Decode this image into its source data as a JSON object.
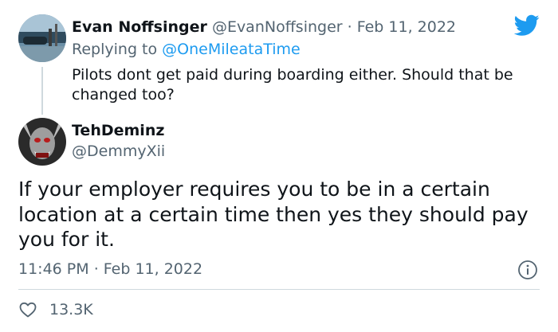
{
  "reply_tweet": {
    "author_name": "Evan Noffsinger",
    "handle": "@EvanNoffsinger",
    "separator": " · ",
    "date": "Feb 11, 2022",
    "replying_prefix": "Replying to ",
    "replying_to": "@OneMileataTime",
    "text": "Pilots dont get paid during boarding either. Should that be changed too?"
  },
  "main_tweet": {
    "author_name": "TehDeminz",
    "handle": "@DemmyXii",
    "text": "If your employer requires you to be in a certain location at a certain time then yes they should pay you for it.",
    "time": "11:46 PM",
    "separator": " · ",
    "date": "Feb 11, 2022",
    "like_count": "13.3K"
  },
  "icons": {
    "brand": "twitter-bird-icon",
    "info": "info-icon",
    "like": "heart-icon"
  },
  "colors": {
    "brand_blue": "#1d9bf0",
    "text_primary": "#0f1419",
    "text_secondary": "#536471",
    "divider": "#cfd9de"
  }
}
